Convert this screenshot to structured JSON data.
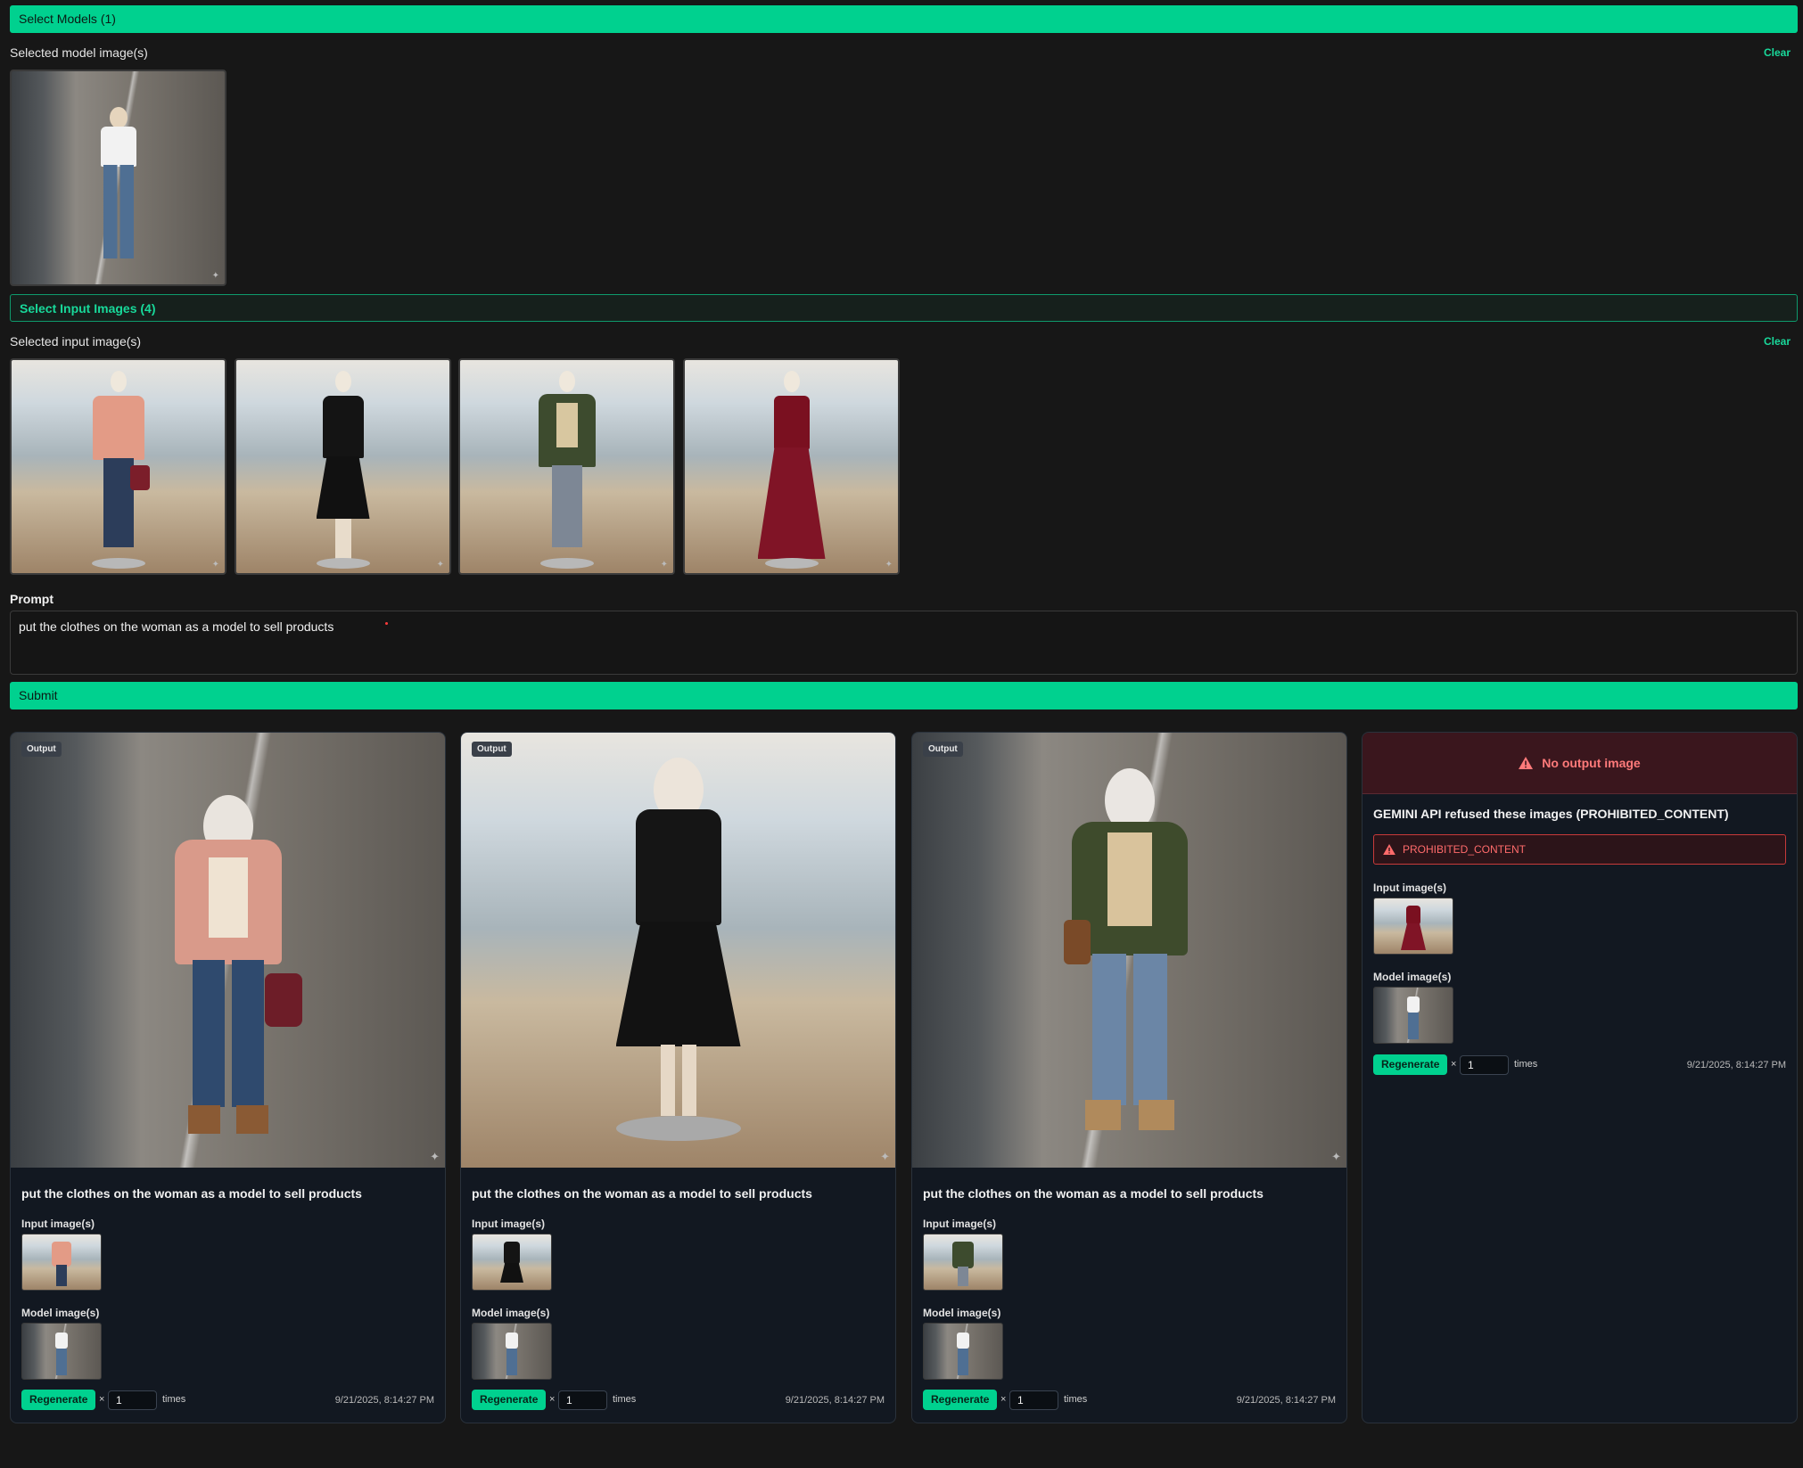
{
  "models": {
    "bar_label": "Select Models (1)",
    "selected_label": "Selected model image(s)",
    "clear_label": "Clear"
  },
  "inputs": {
    "bar_label": "Select Input Images (4)",
    "selected_label": "Selected input image(s)",
    "clear_label": "Clear"
  },
  "prompt": {
    "label": "Prompt",
    "value": "put the clothes on the woman as a model to sell products"
  },
  "submit_label": "Submit",
  "cards": [
    {
      "badge": "Output",
      "prompt": "put the clothes on the woman as a model to sell products",
      "input_label": "Input image(s)",
      "model_label": "Model image(s)",
      "regen_label": "Regenerate",
      "times_x": "×",
      "times_value": "1",
      "times_label": "times",
      "timestamp": "9/21/2025, 8:14:27 PM"
    },
    {
      "badge": "Output",
      "prompt": "put the clothes on the woman as a model to sell products",
      "input_label": "Input image(s)",
      "model_label": "Model image(s)",
      "regen_label": "Regenerate",
      "times_x": "×",
      "times_value": "1",
      "times_label": "times",
      "timestamp": "9/21/2025, 8:14:27 PM"
    },
    {
      "badge": "Output",
      "prompt": "put the clothes on the woman as a model to sell products",
      "input_label": "Input image(s)",
      "model_label": "Model image(s)",
      "regen_label": "Regenerate",
      "times_x": "×",
      "times_value": "1",
      "times_label": "times",
      "timestamp": "9/21/2025, 8:14:27 PM"
    }
  ],
  "error_card": {
    "header": "No output image",
    "title": "GEMINI API refused these images (PROHIBITED_CONTENT)",
    "error_code": "PROHIBITED_CONTENT",
    "input_label": "Input image(s)",
    "model_label": "Model image(s)",
    "regen_label": "Regenerate",
    "times_x": "×",
    "times_value": "1",
    "times_label": "times",
    "timestamp": "9/21/2025, 8:14:27 PM"
  },
  "colors": {
    "accent": "#00d18f",
    "background": "#171717",
    "card_bg": "#121821",
    "error": "#ff6b6b"
  }
}
